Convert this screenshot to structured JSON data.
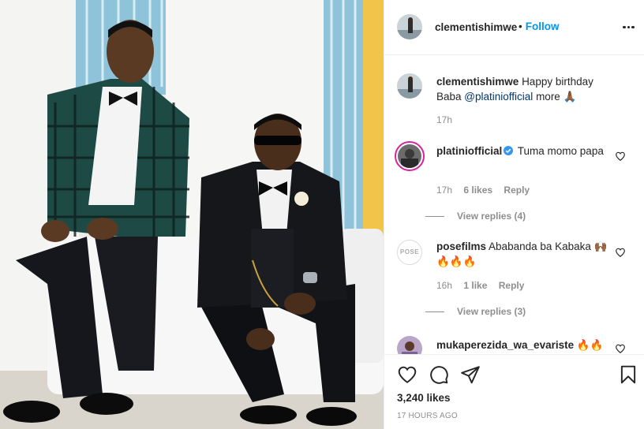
{
  "header": {
    "username": "clementishimwe",
    "separator": "•",
    "follow_label": "Follow",
    "more_icon": "more-horizontal-icon"
  },
  "caption": {
    "username": "clementishimwe",
    "text": "Happy birthday Baba",
    "mention": "@platiniofficial",
    "trailing": "more 🙏🏾",
    "time": "17h"
  },
  "comments": [
    {
      "username": "platiniofficial",
      "verified": true,
      "text": "Tuma momo papa",
      "time": "17h",
      "likes": "6 likes",
      "reply": "Reply",
      "view_replies": "View replies (4)"
    },
    {
      "username": "posefilms",
      "avatar_text": "POSE",
      "text": "Ababanda ba Kabaka 🙌🏾 🔥🔥🔥",
      "time": "16h",
      "likes": "1 like",
      "reply": "Reply",
      "view_replies": "View replies (3)"
    },
    {
      "username": "mukaperezida_wa_evariste",
      "text": "🔥🔥🔥🔥"
    }
  ],
  "actions": {
    "like_icon": "heart-icon",
    "comment_icon": "comment-icon",
    "share_icon": "paper-plane-icon",
    "save_icon": "bookmark-icon"
  },
  "likes_count": "3,240 likes",
  "time_ago": "17 HOURS AGO",
  "colors": {
    "link_blue": "#0095f6",
    "mention": "#00376b",
    "muted": "#8e8e8e",
    "text": "#262626",
    "border": "#efefef"
  }
}
